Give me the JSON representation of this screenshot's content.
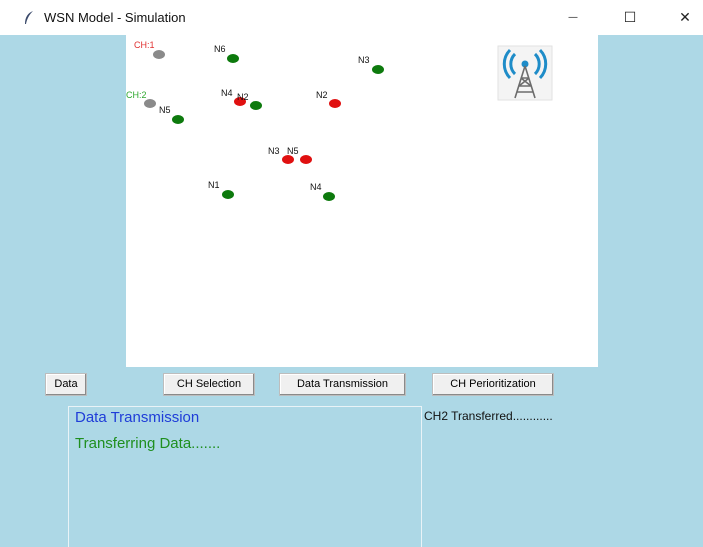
{
  "window": {
    "title": "WSN Model - Simulation",
    "minimize": "—",
    "maximize": "☐",
    "close": "✕"
  },
  "nodes": [
    {
      "label": "CH:1",
      "label_color": "#e03030",
      "dot_color": "#8a8a8a"
    },
    {
      "label": "N6",
      "label_color": "#111111",
      "dot_color": "#0d7a0d"
    },
    {
      "label": "N3",
      "label_color": "#111111",
      "dot_color": "#0d7a0d"
    },
    {
      "label": "CH:2",
      "label_color": "#2ea82e",
      "dot_color": "#8a8a8a"
    },
    {
      "label": "N5",
      "label_color": "#111111",
      "dot_color": "#0d7a0d"
    },
    {
      "label": "N4",
      "label_color": "#111111",
      "dot_color": "#e01010"
    },
    {
      "label": "N2",
      "label_color": "#111111",
      "dot_color": "#0d7a0d"
    },
    {
      "label": "N2",
      "label_color": "#111111",
      "dot_color": "#e01010"
    },
    {
      "label": "N3",
      "label_color": "#111111",
      "dot_color": "#e01010"
    },
    {
      "label": "N5",
      "label_color": "#111111",
      "dot_color": "#e01010"
    },
    {
      "label": "N1",
      "label_color": "#111111",
      "dot_color": "#0d7a0d"
    },
    {
      "label": "N4",
      "label_color": "#111111",
      "dot_color": "#0d7a0d"
    }
  ],
  "base_station_icon": "cell-tower-icon",
  "buttons": {
    "data": "Data",
    "ch_selection": "CH Selection",
    "data_transmission": "Data Transmission",
    "ch_prioritization": "CH Periorітization"
  },
  "log": {
    "title": "Data Transmission",
    "line": "Transferring Data......."
  },
  "status": "CH2 Transferred............",
  "colors": {
    "background": "#add8e6",
    "log_title": "#1f3dd8",
    "log_line": "#1f8f1f"
  }
}
